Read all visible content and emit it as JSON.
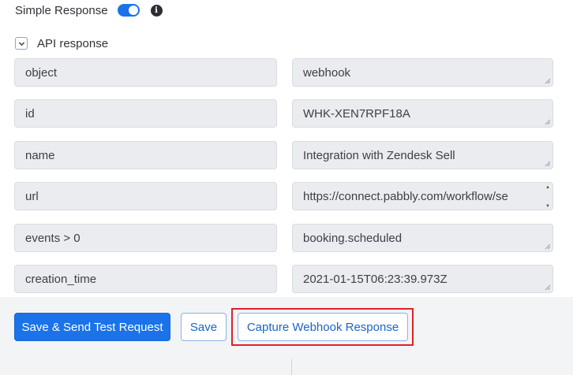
{
  "simple_response": {
    "label": "Simple Response",
    "toggle_on": true,
    "info_icon": "info-icon"
  },
  "api_response": {
    "label": "API response",
    "expand_icon": "chevron-down-icon"
  },
  "fields": [
    {
      "key": "object",
      "value": "webhook"
    },
    {
      "key": "id",
      "value": "WHK-XEN7RPF18A"
    },
    {
      "key": "name",
      "value": "Integration with Zendesk Sell"
    },
    {
      "key": "url",
      "value": "https://connect.pabbly.com/workflow/se"
    },
    {
      "key": "events > 0",
      "value": "booking.scheduled"
    },
    {
      "key": "creation_time",
      "value": "2021-01-15T06:23:39.973Z"
    }
  ],
  "buttons": {
    "save_send": "Save & Send Test Request",
    "save": "Save",
    "capture": "Capture Webhook Response"
  },
  "colors": {
    "accent": "#1a73e8",
    "highlight": "#e0202a",
    "field_bg": "#eaecef"
  }
}
